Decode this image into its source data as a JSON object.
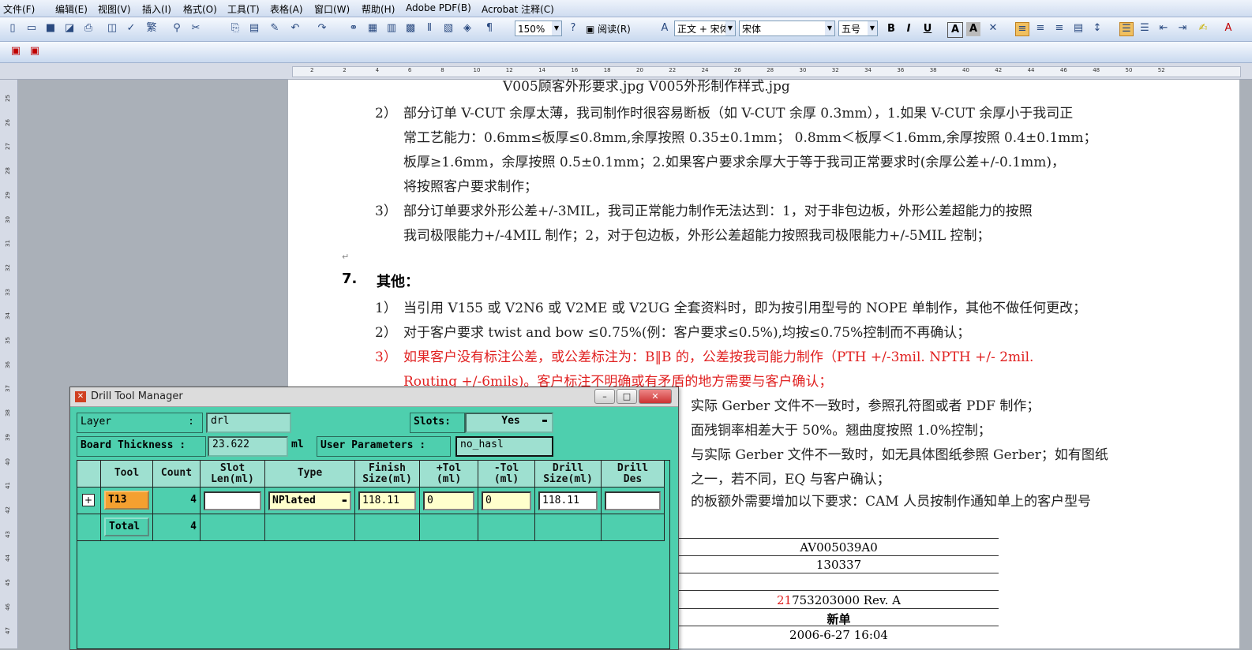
{
  "menu": [
    "文件(F)",
    "编辑(E)",
    "视图(V)",
    "插入(I)",
    "格式(O)",
    "工具(T)",
    "表格(A)",
    "窗口(W)",
    "帮助(H)",
    "Adobe PDF(B)",
    "Acrobat 注释(C)"
  ],
  "toolbar": {
    "zoom": "150%",
    "read_label": "阅读(R)",
    "style": "正文 + 宋体",
    "font": "宋体",
    "size": "五号",
    "bold": "B",
    "italic": "I",
    "underline": "U",
    "fontcolor": "A"
  },
  "ruler_ticks": [
    "2",
    "2",
    "4",
    "6",
    "8",
    "10",
    "12",
    "14",
    "16",
    "18",
    "20",
    "22",
    "24",
    "26",
    "28",
    "30",
    "32",
    "34",
    "36",
    "38",
    "40",
    "42",
    "44",
    "46",
    "48",
    "50",
    "52"
  ],
  "vruler_ticks": [
    "25",
    "26",
    "27",
    "28",
    "29",
    "30",
    "31",
    "32",
    "33",
    "34",
    "35",
    "36",
    "37",
    "38",
    "39",
    "40",
    "41",
    "42",
    "43",
    "44",
    "45",
    "46",
    "47"
  ],
  "doc": {
    "top_partial": "V005顾客外形要求.jpg          V005外形制作样式.jpg",
    "items": [
      {
        "num": "2）",
        "lines": [
          "部分订单 V-CUT 余厚太薄，我司制作时很容易断板（如 V-CUT 余厚 0.3mm），1.如果 V-CUT 余厚小于我司正",
          "常工艺能力：0.6mm≤板厚≤0.8mm,余厚按照 0.35±0.1mm； 0.8mm＜板厚＜1.6mm,余厚按照 0.4±0.1mm；",
          "板厚≥1.6mm，余厚按照 0.5±0.1mm；2.如果客户要求余厚大于等于我司正常要求时(余厚公差+/-0.1mm)，",
          "将按照客户要求制作；"
        ]
      },
      {
        "num": "3）",
        "lines": [
          "部分订单要求外形公差+/-3MIL，我司正常能力制作无法达到：1，对于非包边板，外形公差超能力的按照",
          "我司极限能力+/-4MIL 制作；2，对于包边板，外形公差超能力按照我司极限能力+/-5MIL 控制；"
        ]
      }
    ],
    "section7_num": "7.",
    "section7_title": "其他：",
    "s7": [
      "当引用 V155 或 V2N6 或 V2ME 或 V2UG 全套资料时，即为按引用型号的 NOPE 单制作，其他不做任何更改；",
      "对于客户要求 twist and bow ≤0.75%(例：客户要求≤0.5%),均按≤0.75%控制而不再确认；"
    ],
    "s7_red": [
      "如果客户没有标注公差，或公差标注为：B‖B 的，公差按我司能力制作（PTH +/-3mil. NPTH +/- 2mil.",
      "Routing +/-6mils)。客户标注不明确或有矛盾的地方需要与客户确认；"
    ],
    "s7_nums": [
      "1）",
      "2）",
      "3）"
    ],
    "s7_tail": [
      "实际 Gerber 文件不一致时，参照孔符图或者 PDF 制作；",
      "面残铜率相差大于 50%。翘曲度按照 1.0%控制；",
      "与实际 Gerber 文件不一致时，如无具体图纸参照 Gerber；如有图纸",
      "之一，若不同，EQ 与客户确认；",
      "的板额外需要增加以下要求：CAM 人员按制作通知单上的客户型号"
    ],
    "table_rows": [
      "AV005039A0",
      "130337",
      "",
      "21753203000 Rev. A",
      "新单",
      "2006-6-27 16:04"
    ],
    "table_red_prefix": "21"
  },
  "dtm": {
    "title": "Drill Tool Manager",
    "layer_label": "Layer",
    "layer_colon": ":",
    "layer_value": "drl",
    "slots_label": "Slots:",
    "slots_value": "Yes",
    "board_label": "Board Thickness :",
    "board_value": "23.622",
    "board_unit": "ml",
    "userparam_label": "User Parameters :",
    "userparam_value": "no_hasl",
    "headers": [
      "Tool",
      "Count",
      "Slot\nLen(ml)",
      "Type",
      "Finish\nSize(ml)",
      "+Tol\n(ml)",
      "-Tol\n(ml)",
      "Drill\nSize(ml)",
      "Drill\nDes"
    ],
    "row1": {
      "tool": "T13",
      "count": "4",
      "slot": "",
      "type": "NPlated",
      "finish": "118.11",
      "ptol": "0",
      "ntol": "0",
      "drill": "118.11",
      "des": ""
    },
    "total": {
      "label": "Total",
      "count": "4"
    }
  }
}
